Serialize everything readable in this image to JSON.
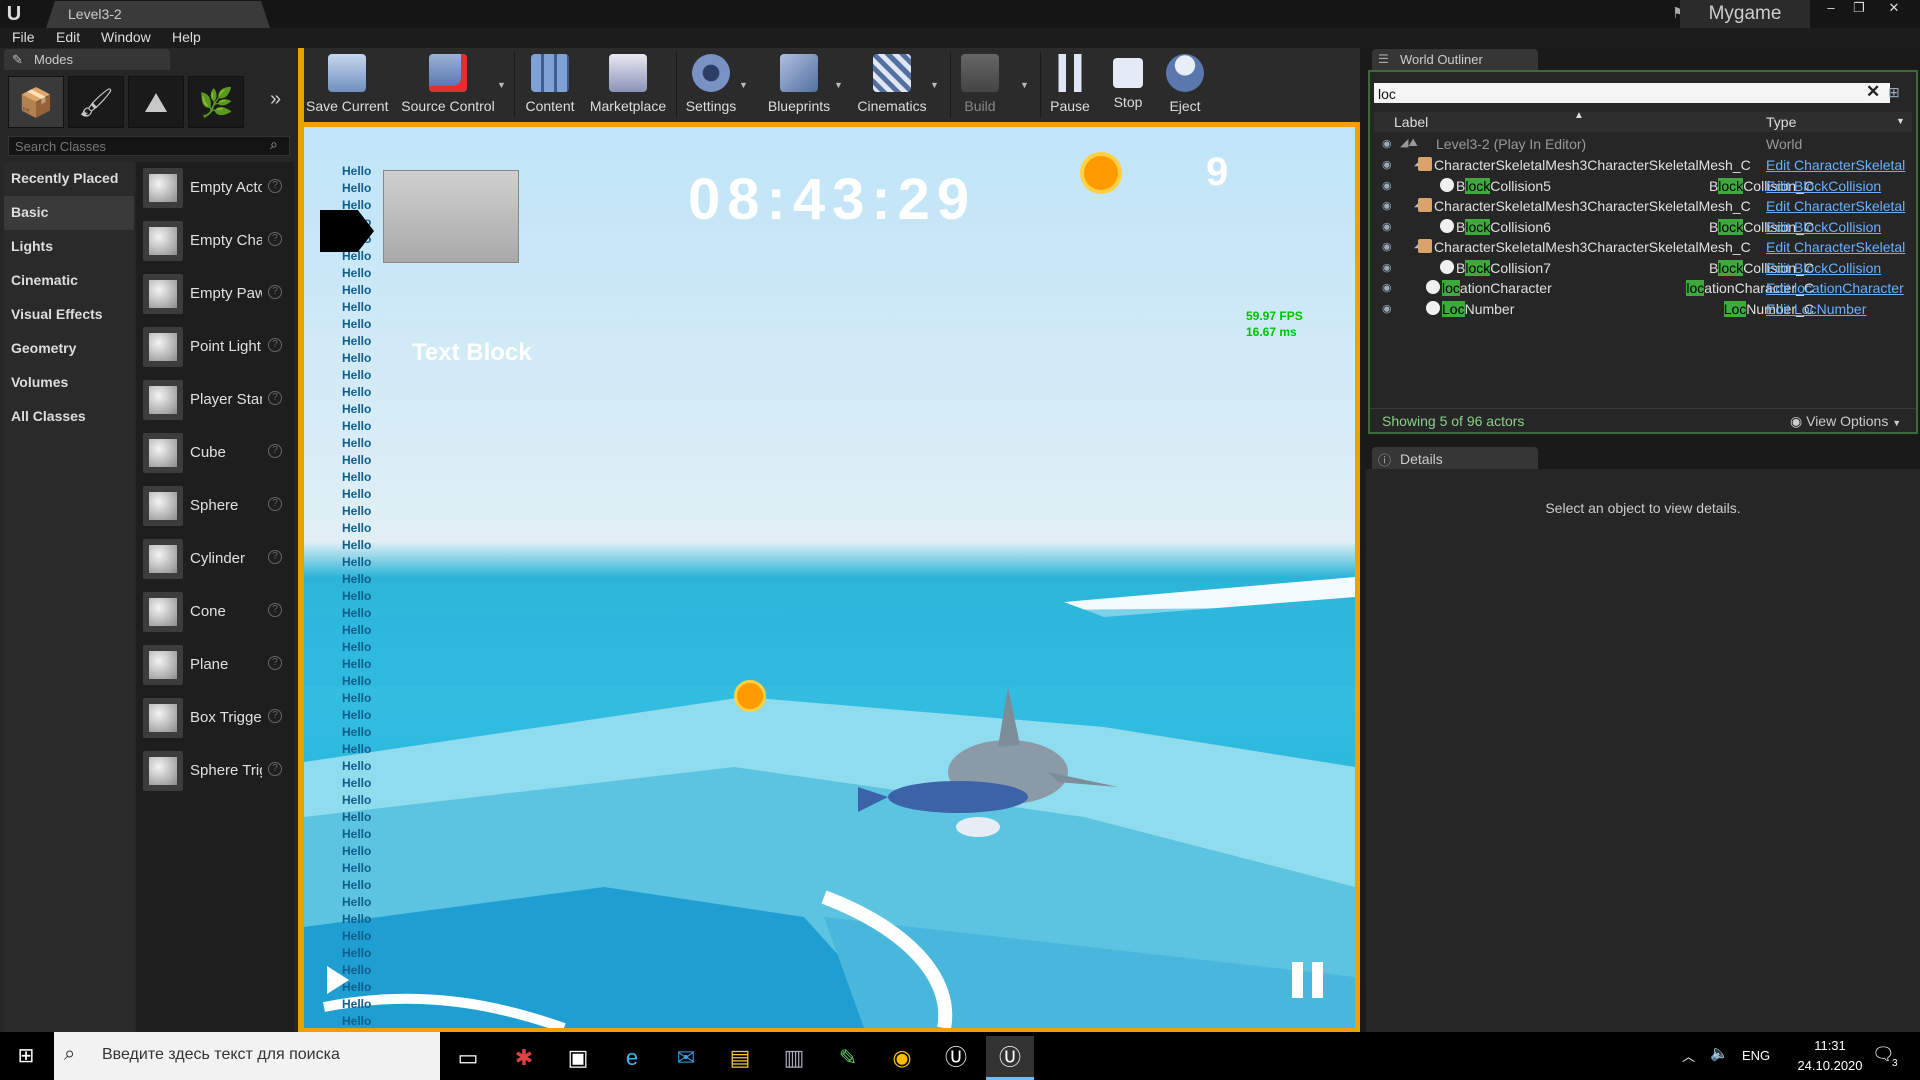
{
  "window": {
    "title": "Level3-2",
    "app_name": "Mygame",
    "minimize": "–",
    "restore": "❐",
    "close": "✕"
  },
  "menu": [
    "File",
    "Edit",
    "Window",
    "Help"
  ],
  "modes": {
    "tab_label": "Modes",
    "search_placeholder": "Search Classes",
    "categories": [
      "Recently Placed",
      "Basic",
      "Lights",
      "Cinematic",
      "Visual Effects",
      "Geometry",
      "Volumes",
      "All Classes"
    ],
    "selected_category": "Basic",
    "items": [
      "Empty Actor",
      "Empty Character",
      "Empty Pawn",
      "Point Light",
      "Player Start",
      "Cube",
      "Sphere",
      "Cylinder",
      "Cone",
      "Plane",
      "Box Trigger",
      "Sphere Trigger"
    ]
  },
  "toolbar": {
    "save": "Save Current",
    "source": "Source Control",
    "content": "Content",
    "marketplace": "Marketplace",
    "settings": "Settings",
    "blueprints": "Blueprints",
    "cinematics": "Cinematics",
    "build": "Build",
    "pause": "Pause",
    "stop": "Stop",
    "eject": "Eject"
  },
  "viewport": {
    "timer": "08:43:29",
    "counter": "9",
    "fps": "59.97 FPS",
    "ms": "16.67 ms",
    "text_block": "Text Block",
    "hello_text": "Hello",
    "hello_count": 51
  },
  "outliner": {
    "tab_label": "World Outliner",
    "search_value": "loc",
    "col_label": "Label",
    "col_type": "Type",
    "root": {
      "name": "Level3-2 (Play In Editor)",
      "type": "World"
    },
    "rows": [
      {
        "pre": "CharacterSkeletalMesh3CharacterSkeletalMesh_C",
        "hl": "",
        "post": "",
        "tpre": "",
        "thl": "",
        "tpost": "",
        "edit": "Edit CharacterSkeletal"
      },
      {
        "pre": "B",
        "hl": "lock",
        "post": "Collision5",
        "tpre": "B",
        "thl": "lock",
        "tpost": "Collision_C",
        "edit": "Edit BlockCollision"
      },
      {
        "pre": "CharacterSkeletalMesh3CharacterSkeletalMesh_C",
        "hl": "",
        "post": "",
        "tpre": "",
        "thl": "",
        "tpost": "",
        "edit": "Edit CharacterSkeletal"
      },
      {
        "pre": "B",
        "hl": "lock",
        "post": "Collision6",
        "tpre": "B",
        "thl": "lock",
        "tpost": "Collision_C",
        "edit": "Edit BlockCollision"
      },
      {
        "pre": "CharacterSkeletalMesh3CharacterSkeletalMesh_C",
        "hl": "",
        "post": "",
        "tpre": "",
        "thl": "",
        "tpost": "",
        "edit": "Edit CharacterSkeletal"
      },
      {
        "pre": "B",
        "hl": "lock",
        "post": "Collision7",
        "tpre": "B",
        "thl": "lock",
        "tpost": "Collision_C",
        "edit": "Edit BlockCollision"
      },
      {
        "pre": "",
        "hl": "loc",
        "post": "ationCharacter",
        "tpre": "",
        "thl": "loc",
        "tpost": "ationCharacter_C",
        "edit": "Edit locationCharacter"
      },
      {
        "pre": "",
        "hl": "Loc",
        "post": "Number",
        "tpre": "",
        "thl": "Loc",
        "tpost": "Number_C",
        "edit": "Edit LocNumber"
      }
    ],
    "status": "Showing 5 of 96 actors",
    "view_options": "View Options"
  },
  "details": {
    "tab_label": "Details",
    "message": "Select an object to view details."
  },
  "taskbar": {
    "search_placeholder": "Введите здесь текст для поиска",
    "lang": "ENG",
    "time": "11:31",
    "date": "24.10.2020",
    "notifications": "3"
  }
}
